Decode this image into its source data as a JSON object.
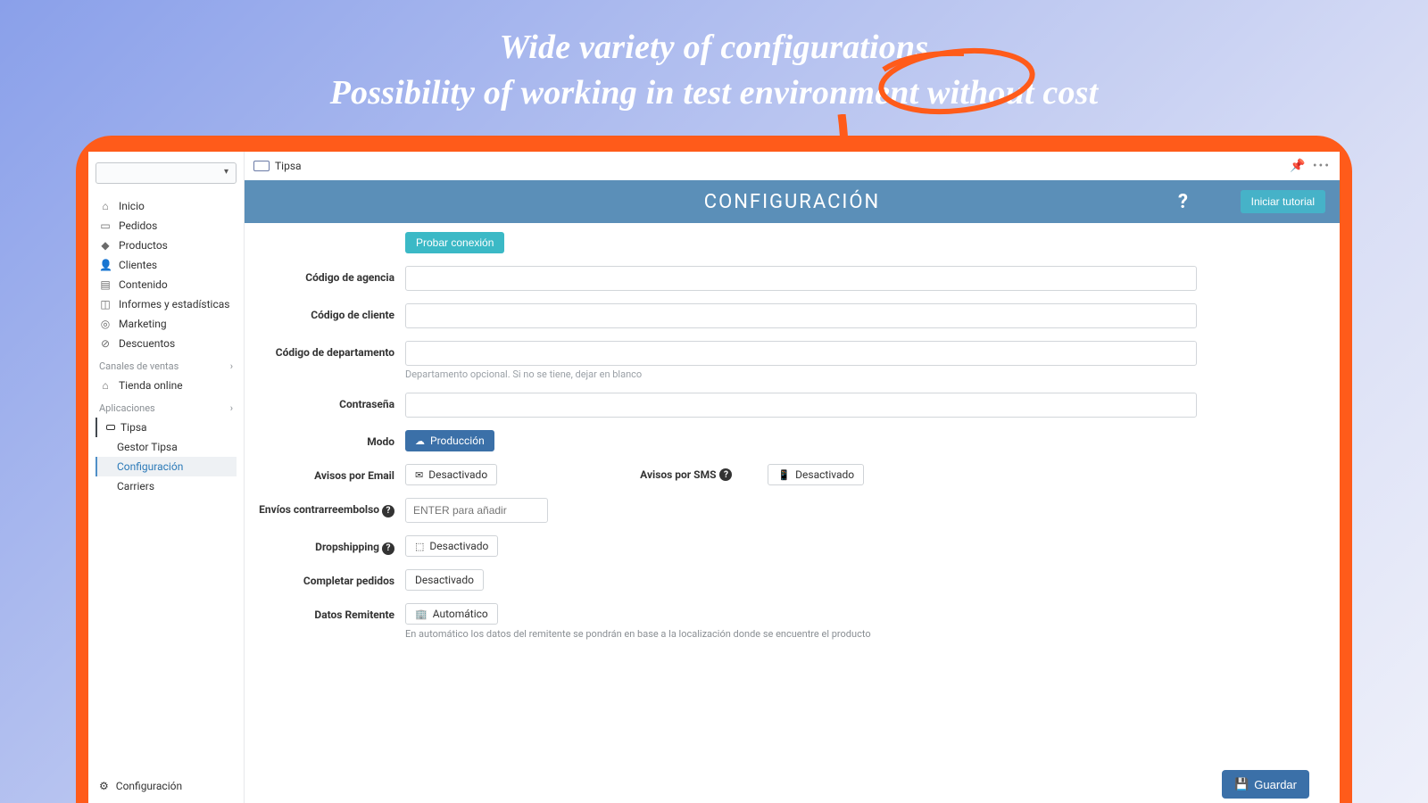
{
  "hero": {
    "line1": "Wide variety of configurations",
    "line2": "Possibility of working in test environment without cost"
  },
  "topbar": {
    "app": "Tipsa"
  },
  "banner": {
    "title": "CONFIGURACIÓN",
    "tutorial": "Iniciar tutorial"
  },
  "sidebar": {
    "inicio": "Inicio",
    "pedidos": "Pedidos",
    "productos": "Productos",
    "clientes": "Clientes",
    "contenido": "Contenido",
    "informes": "Informes y estadísticas",
    "marketing": "Marketing",
    "descuentos": "Descuentos",
    "canales": "Canales de ventas",
    "tienda": "Tienda online",
    "apps_title": "Aplicaciones",
    "tipsa": "Tipsa",
    "gestor": "Gestor Tipsa",
    "config": "Configuración",
    "carriers": "Carriers",
    "bottom_cfg": "Configuración"
  },
  "form": {
    "probar": "Probar conexión",
    "agencia": "Código de agencia",
    "cliente": "Código de cliente",
    "departamento": "Código de departamento",
    "departamento_hint": "Departamento opcional. Si no se tiene, dejar en blanco",
    "contrasena": "Contraseña",
    "modo": "Modo",
    "modo_val": "Producción",
    "avisos_email": "Avisos por Email",
    "desactivado": "Desactivado",
    "avisos_sms": "Avisos por SMS",
    "reembolso": "Envíos contrarreembolso",
    "reembolso_ph": "ENTER para añadir",
    "dropshipping": "Dropshipping",
    "completar": "Completar pedidos",
    "remitente": "Datos Remitente",
    "automatico": "Automático",
    "remitente_help": "En automático los datos del remitente se pondrán en base a la localización donde se encuentre el producto",
    "guardar": "Guardar"
  }
}
